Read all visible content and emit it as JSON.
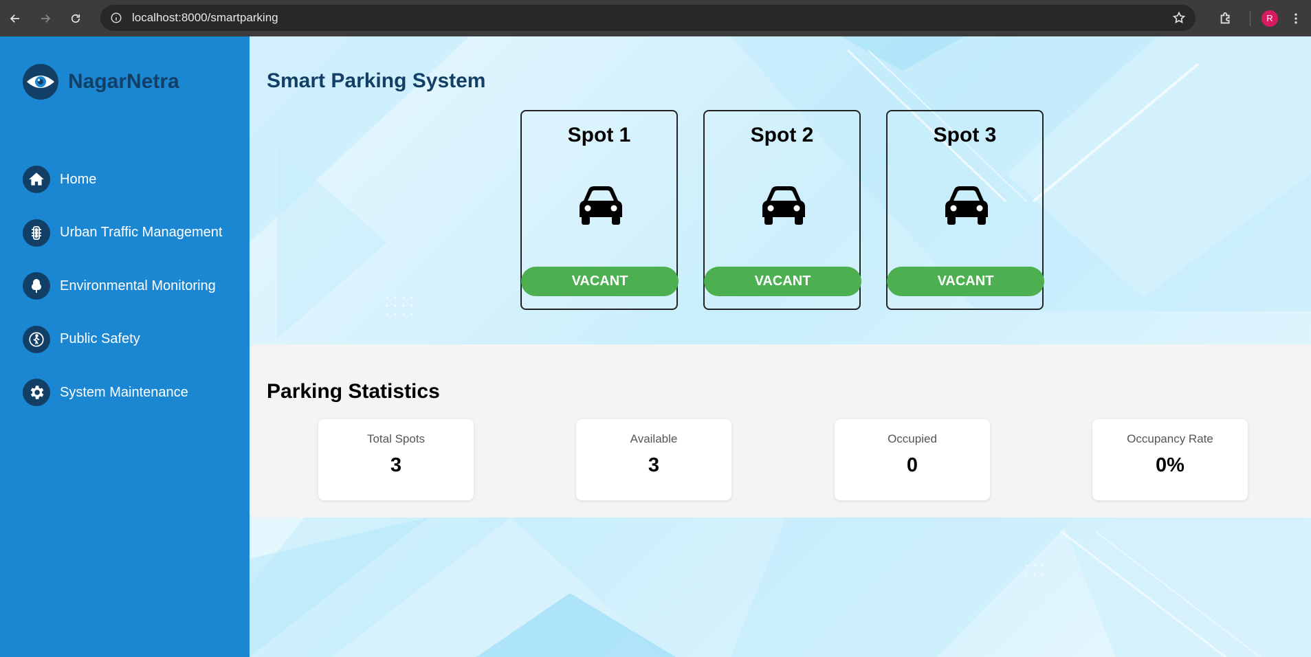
{
  "browser": {
    "url": "localhost:8000/smartparking",
    "profile_initial": "R"
  },
  "sidebar": {
    "brand": "NagarNetra",
    "items": [
      {
        "label": "Home",
        "icon": "home-icon"
      },
      {
        "label": "Urban Traffic Management",
        "icon": "traffic-light-icon"
      },
      {
        "label": "Environmental Monitoring",
        "icon": "tree-icon"
      },
      {
        "label": "Public Safety",
        "icon": "pedestrian-icon"
      },
      {
        "label": "System Maintenance",
        "icon": "gear-icon"
      }
    ]
  },
  "main": {
    "title": "Smart Parking System",
    "spots": [
      {
        "name": "Spot 1",
        "status": "VACANT"
      },
      {
        "name": "Spot 2",
        "status": "VACANT"
      },
      {
        "name": "Spot 3",
        "status": "VACANT"
      }
    ],
    "stats": {
      "title": "Parking Statistics",
      "cards": [
        {
          "label": "Total Spots",
          "value": "3"
        },
        {
          "label": "Available",
          "value": "3"
        },
        {
          "label": "Occupied",
          "value": "0"
        },
        {
          "label": "Occupancy Rate",
          "value": "0%"
        }
      ]
    }
  },
  "colors": {
    "sidebar_bg": "#1b87d2",
    "brand_dark": "#123f66",
    "vacant_green": "#4caf50",
    "chrome_bg": "#3c3c3c"
  }
}
